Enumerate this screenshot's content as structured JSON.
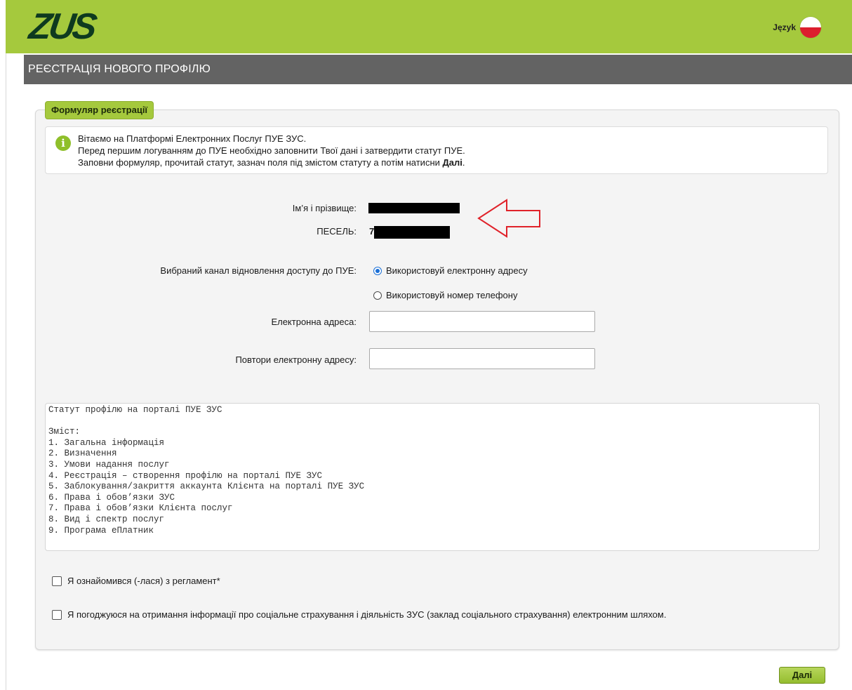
{
  "header": {
    "logo": "ZUS",
    "language_label": "Język"
  },
  "page": {
    "title": "РЕЄСТРАЦІЯ НОВОГО ПРОФІЛЮ"
  },
  "form": {
    "legend": "Формуляр реєстрації",
    "info": {
      "line1": "Вітаємо на Платформі Електронних Послуг ПУЕ ЗУС.",
      "line2": "Перед першим логуванням до ПУЕ необхідно заповнити Твої дані і затвердити статут ПУЕ.",
      "line3_prefix": "Заповни формуляр, прочитай статут, зазнач поля під змістом статуту а потім натисни ",
      "line3_bold": "Далі",
      "line3_suffix": "."
    },
    "name_label": "Ім’я і прізвище:",
    "pesel_label": "ПЕСЕЛЬ:",
    "pesel_visible_char": "7",
    "channel_label": "Вибраний канал відновлення доступу до ПУЕ:",
    "channel_options": [
      {
        "label": "Використовуй електронну адресу",
        "selected": true
      },
      {
        "label": "Використовуй номер телефону",
        "selected": false
      }
    ],
    "email_label": "Електронна адреса:",
    "email_value": "",
    "email_repeat_label": "Повтори електронну адресу:",
    "email_repeat_value": ""
  },
  "statute": {
    "lines": [
      "Статут профілю на порталі ПУЕ ЗУС",
      "",
      "Зміст:",
      "1. Загальна інформація",
      "2. Визначення",
      "3. Умови надання послуг",
      "4. Реєстрація – створення профілю на порталі ПУЕ ЗУС",
      "5. Заблокування/закриття аккаунта Клієнта на порталі ПУЕ ЗУС",
      "6. Права і обов’язки ЗУС",
      "7. Права і обов’язки Клієнта послуг",
      "8. Вид і спектр послуг",
      "9. Програма еПлатник"
    ]
  },
  "consents": {
    "regulation": "Я ознайомився (-лася) з регламент*",
    "info_agree": "Я погоджуюся на отримання інформації про соціальне страхування і діяльність ЗУС (заклад соціального страхування) електронним шляхом."
  },
  "actions": {
    "next": "Далі"
  },
  "colors": {
    "brand_green": "#a5c93d",
    "header_gray": "#636363",
    "arrow_red": "#e0222a"
  }
}
